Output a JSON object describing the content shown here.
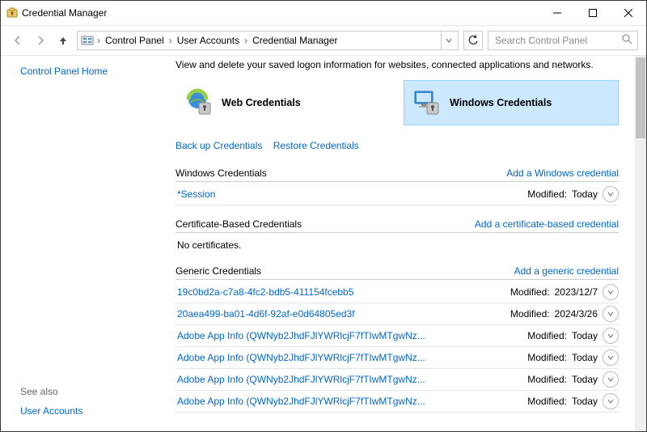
{
  "window": {
    "title": "Credential Manager"
  },
  "breadcrumb": {
    "items": [
      "Control Panel",
      "User Accounts",
      "Credential Manager"
    ]
  },
  "search": {
    "placeholder": "Search Control Panel"
  },
  "sidebar": {
    "home": "Control Panel Home",
    "see_also": "See also",
    "user_accounts": "User Accounts"
  },
  "content": {
    "intro": "View and delete your saved logon information for websites, connected applications and networks.",
    "tiles": {
      "web": "Web Credentials",
      "windows": "Windows Credentials"
    },
    "links": {
      "backup": "Back up Credentials",
      "restore": "Restore Credentials"
    },
    "sections": {
      "windows": {
        "title": "Windows Credentials",
        "action": "Add a Windows credential",
        "rows": [
          {
            "name": "*Session",
            "mod": "Modified:",
            "when": "Today"
          }
        ]
      },
      "cert": {
        "title": "Certificate-Based Credentials",
        "action": "Add a certificate-based credential",
        "empty": "No certificates."
      },
      "generic": {
        "title": "Generic Credentials",
        "action": "Add a generic credential",
        "rows": [
          {
            "name": "19c0bd2a-c7a8-4fc2-bdb5-411154fcebb5",
            "mod": "Modified:",
            "when": "2023/12/7"
          },
          {
            "name": "20aea499-ba01-4d6f-92af-e0d64805ed3f",
            "mod": "Modified:",
            "when": "2024/3/26"
          },
          {
            "name": "Adobe App Info (QWNyb2JhdFJlYWRlcjF7fTIwMTgwNz...",
            "mod": "Modified:",
            "when": "Today"
          },
          {
            "name": "Adobe App Info (QWNyb2JhdFJlYWRlcjF7fTIwMTgwNz...",
            "mod": "Modified:",
            "when": "Today"
          },
          {
            "name": "Adobe App Info (QWNyb2JhdFJlYWRlcjF7fTIwMTgwNz...",
            "mod": "Modified:",
            "when": "Today"
          },
          {
            "name": "Adobe App Info (QWNyb2JhdFJlYWRlcjF7fTIwMTgwNz...",
            "mod": "Modified:",
            "when": "Today"
          }
        ]
      }
    }
  }
}
